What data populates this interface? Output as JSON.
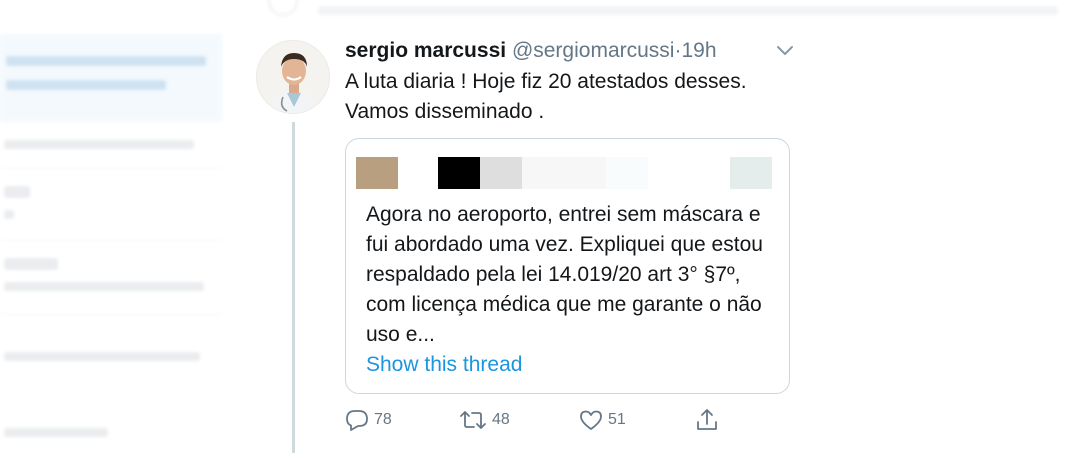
{
  "tweet": {
    "display_name": "sergio marcussi",
    "handle": "@sergiomarcussi",
    "separator": "·",
    "time": "19h",
    "text": "A luta diaria ! Hoje fiz 20 atestados desses. Vamos disseminado .",
    "quoted": {
      "text": "Agora no aeroporto, entrei sem máscara e fui abordado uma vez. Expliquei que estou respaldado pela lei 14.019/20 art 3° §7º, com licença médica que me garante o não uso e...",
      "show_thread_label": "Show this thread",
      "redacted_header_colors": [
        "#b89f7f",
        "#000000",
        "#dedede",
        "#f7f7f7",
        "#f8fcfd",
        "#e4ecec"
      ]
    },
    "actions": {
      "reply_count": "78",
      "retweet_count": "48",
      "like_count": "51"
    }
  },
  "icons": [
    "chevron-down-icon",
    "reply-icon",
    "retweet-icon",
    "like-icon",
    "share-icon"
  ],
  "colors": {
    "link": "#1b95e0",
    "secondary_text": "#657786",
    "border": "#ccd6dd"
  }
}
